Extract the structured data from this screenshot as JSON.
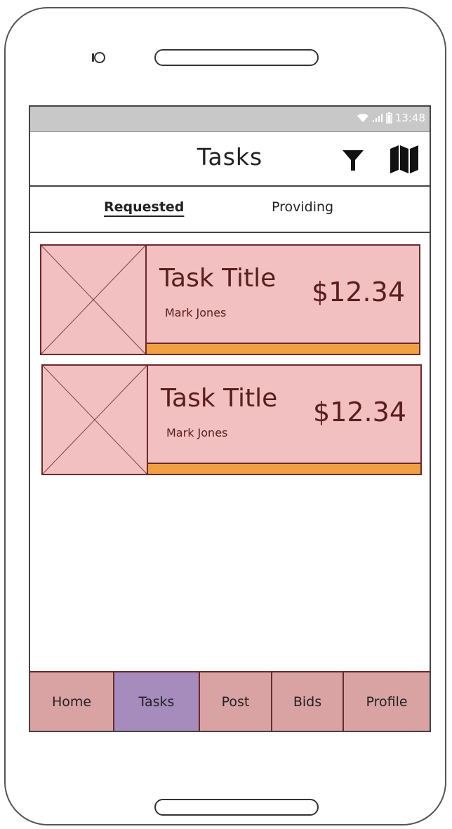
{
  "status_bar": {
    "time": "13:48"
  },
  "header": {
    "title": "Tasks"
  },
  "tabs": [
    {
      "label": "Requested",
      "active": true
    },
    {
      "label": "Providing",
      "active": false
    }
  ],
  "tasks": [
    {
      "title": "Task Title",
      "user": "Mark Jones",
      "price": "$12.34"
    },
    {
      "title": "Task Title",
      "user": "Mark Jones",
      "price": "$12.34"
    }
  ],
  "nav": {
    "active": "Tasks",
    "items": [
      {
        "label": "Home"
      },
      {
        "label": "Tasks"
      },
      {
        "label": "Post"
      },
      {
        "label": "Bids"
      },
      {
        "label": "Profile"
      }
    ]
  },
  "colors": {
    "card_bg": "#f2c0c0",
    "card_accent": "#f0a043",
    "nav_bg": "#d9a3a3",
    "nav_active": "#a68bbd"
  }
}
